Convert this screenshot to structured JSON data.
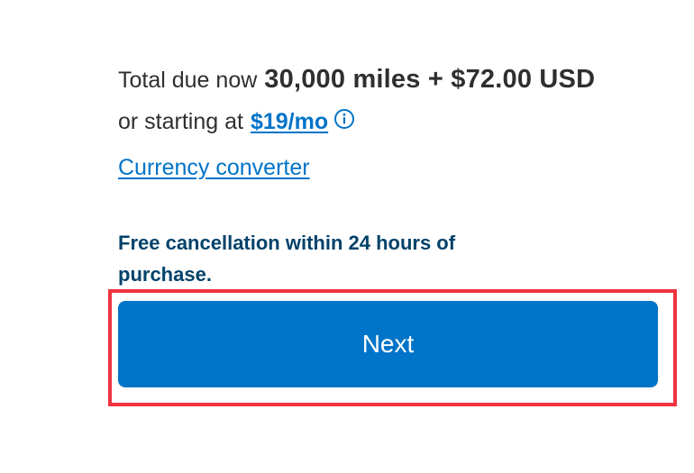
{
  "payment_summary": {
    "total_label": "Total due now",
    "total_amount": "30,000 miles + $72.00 USD",
    "starting_label": "or starting at",
    "monthly_link_text": "$19/mo",
    "info_icon": "info-circle-icon"
  },
  "currency_converter_link": "Currency converter",
  "cancellation_note": "Free cancellation within 24 hours of purchase.",
  "next_button_label": "Next",
  "colors": {
    "primary_blue": "#0074c8",
    "navy_text": "#01426a",
    "body_text": "#2f2f2f",
    "highlight_red": "#ef3340",
    "button_text": "#ffffff"
  }
}
